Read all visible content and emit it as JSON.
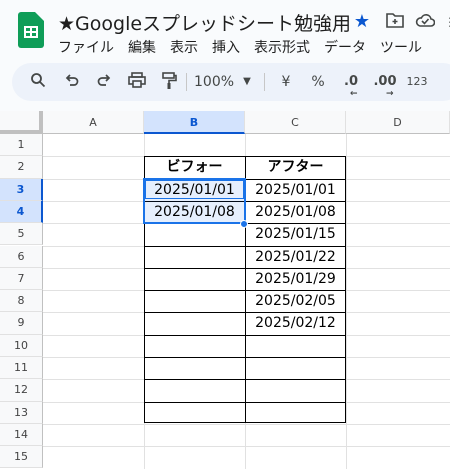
{
  "app": {
    "title": "★Googleスプレッドシート勉強用",
    "menu": [
      "ファイル",
      "編集",
      "表示",
      "挿入",
      "表示形式",
      "データ",
      "ツール"
    ]
  },
  "toolbar": {
    "zoom": "100%",
    "currency": "¥",
    "percent": "%",
    "dec_minus": ".0",
    "dec_plus": ".00",
    "number_format": "123"
  },
  "grid": {
    "columns": [
      "A",
      "B",
      "C",
      "D"
    ],
    "rows": [
      "1",
      "2",
      "3",
      "4",
      "5",
      "6",
      "7",
      "8",
      "9",
      "10",
      "11",
      "12",
      "13",
      "14",
      "15"
    ],
    "selected_column": "B",
    "selected_rows": [
      "3",
      "4"
    ],
    "header_before": "ビフォー",
    "header_after": "アフター",
    "before_values": [
      "2025/01/01",
      "2025/01/08",
      "",
      "",
      "",
      "",
      "",
      "",
      "",
      "",
      ""
    ],
    "after_values": [
      "2025/01/01",
      "2025/01/08",
      "2025/01/15",
      "2025/01/22",
      "2025/01/29",
      "2025/02/05",
      "2025/02/12",
      "",
      "",
      "",
      ""
    ]
  },
  "colors": {
    "sheets_green": "#0f9d58",
    "selection_blue": "#1a73e8",
    "star_blue": "#0b57d0"
  }
}
